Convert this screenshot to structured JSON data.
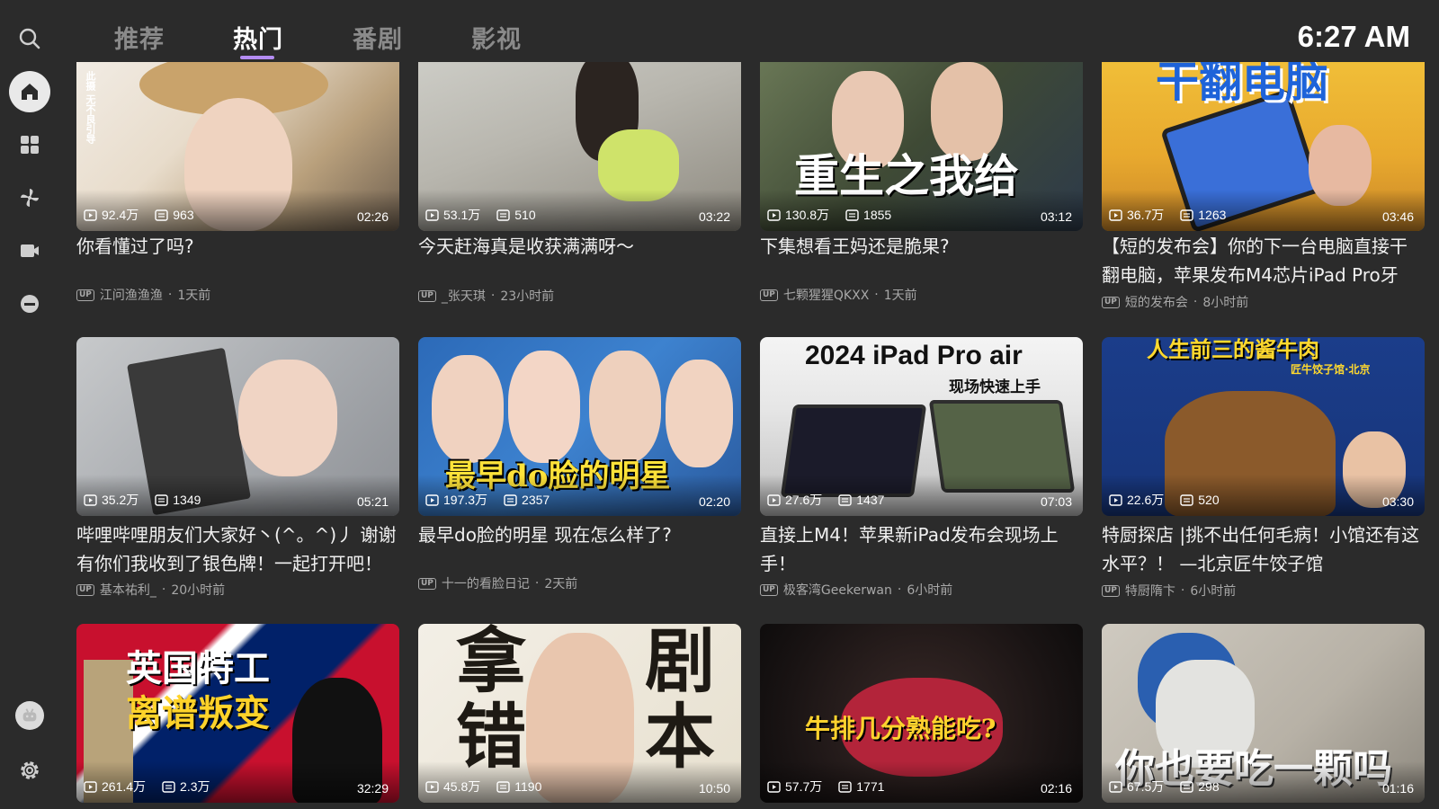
{
  "nav": {
    "tabs": [
      {
        "label": "推荐"
      },
      {
        "label": "热门"
      },
      {
        "label": "番剧"
      },
      {
        "label": "影视"
      }
    ],
    "active_tab": "热门",
    "clock": "6:27 AM"
  },
  "sidebar": {
    "icons": [
      "search-icon",
      "home-icon",
      "category-icon",
      "pinwheel-icon",
      "video-camera-icon",
      "live-icon"
    ],
    "bottom_icons": [
      "avatar",
      "settings-icon"
    ]
  },
  "colors": {
    "accent": "#b48cf2",
    "background": "#2b2b2b"
  },
  "videos": [
    {
      "title": "你看懂过了吗?",
      "up": "江问渔渔渔",
      "time": "1天前",
      "views": "92.4万",
      "danmaku": "963",
      "duration": "02:26",
      "thumb_text": "此摄 无不良引导"
    },
    {
      "title": "今天赶海真是收获满满呀～",
      "up": "_张天琪",
      "time": "23小时前",
      "views": "53.1万",
      "danmaku": "510",
      "duration": "03:22",
      "thumb_text": ""
    },
    {
      "title": "下集想看王妈还是脆果?",
      "up": "七颗猩猩QKXX",
      "time": "1天前",
      "views": "130.8万",
      "danmaku": "1855",
      "duration": "03:12",
      "thumb_text": "重生之我给"
    },
    {
      "title": "【短的发布会】你的下一台电脑直接干翻电脑，苹果发布M4芯片iPad Pro牙",
      "up": "短的发布会",
      "time": "8小时前",
      "views": "36.7万",
      "danmaku": "1263",
      "duration": "03:46",
      "thumb_text": "干翻电脑"
    },
    {
      "title": "哔哩哔哩朋友们大家好丶(^。^)丿 谢谢有你们我收到了银色牌！一起打开吧！",
      "up": "基本祐利_",
      "time": "20小时前",
      "views": "35.2万",
      "danmaku": "1349",
      "duration": "05:21",
      "thumb_text": ""
    },
    {
      "title": "最早do脸的明星 现在怎么样了?",
      "up": "十一的看脸日记",
      "time": "2天前",
      "views": "197.3万",
      "danmaku": "2357",
      "duration": "02:20",
      "thumb_text": "最早do脸的明星"
    },
    {
      "title": "直接上M4！苹果新iPad发布会现场上手！",
      "up": "极客湾Geekerwan",
      "time": "6小时前",
      "views": "27.6万",
      "danmaku": "1437",
      "duration": "07:03",
      "thumb_text": "2024 iPad Pro air",
      "thumb_text2": "现场快速上手"
    },
    {
      "title": "特厨探店 |挑不出任何毛病！小馆还有这水平？！ —北京匠牛饺子馆",
      "up": "特厨隋卞",
      "time": "6小时前",
      "views": "22.6万",
      "danmaku": "520",
      "duration": "03:30",
      "thumb_text": "人生前三的酱牛肉",
      "thumb_text2": "匠牛饺子馆·北京"
    },
    {
      "title": "",
      "up": "",
      "time": "",
      "views": "261.4万",
      "danmaku": "2.3万",
      "duration": "32:29",
      "thumb_text": "英国特工",
      "thumb_text2": "离谱叛变"
    },
    {
      "title": "",
      "up": "",
      "time": "",
      "views": "45.8万",
      "danmaku": "1190",
      "duration": "10:50",
      "thumb_text": "拿错剧本"
    },
    {
      "title": "",
      "up": "",
      "time": "",
      "views": "57.7万",
      "danmaku": "1771",
      "duration": "02:16",
      "thumb_text": "牛排几分熟能吃?"
    },
    {
      "title": "",
      "up": "",
      "time": "",
      "views": "67.5万",
      "danmaku": "298",
      "duration": "01:16",
      "thumb_text": "你也要吃一颗吗"
    }
  ]
}
